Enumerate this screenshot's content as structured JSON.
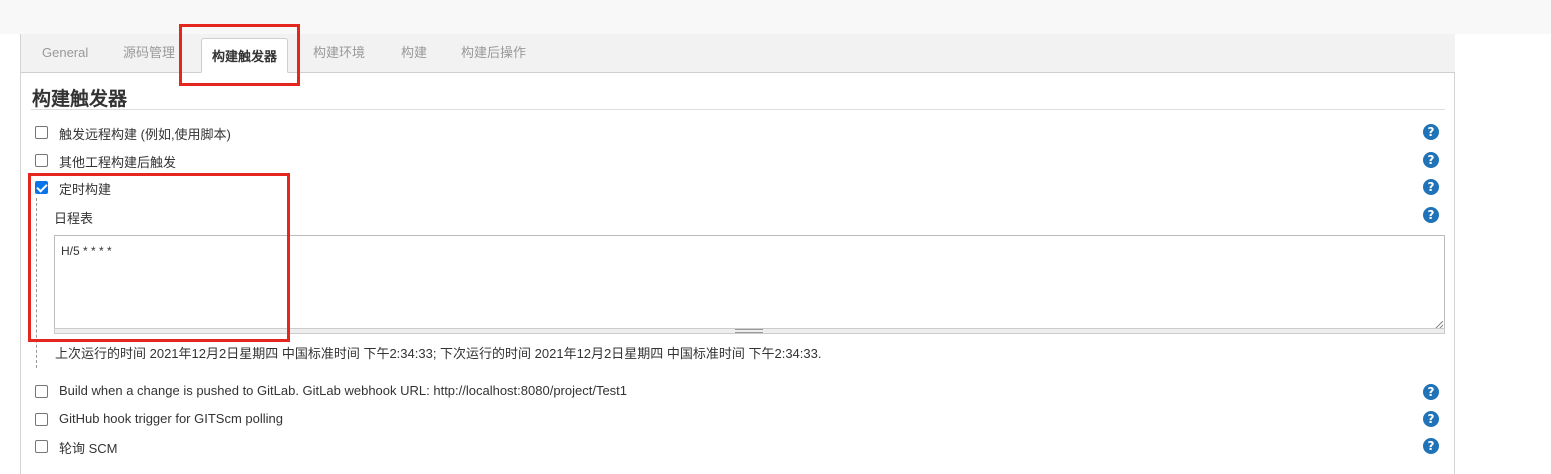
{
  "tabs": [
    {
      "label": "General"
    },
    {
      "label": "源码管理"
    },
    {
      "label": "构建触发器",
      "active": true
    },
    {
      "label": "构建环境"
    },
    {
      "label": "构建"
    },
    {
      "label": "构建后操作"
    }
  ],
  "section": {
    "title": "构建触发器"
  },
  "triggers": [
    {
      "label": "触发远程构建 (例如,使用脚本)",
      "checked": false
    },
    {
      "label": "其他工程构建后触发",
      "checked": false
    },
    {
      "label": "定时构建",
      "checked": true
    },
    {
      "label": "Build when a change is pushed to GitLab. GitLab webhook URL: http://localhost:8080/project/Test1",
      "checked": false
    },
    {
      "label": "GitHub hook trigger for GITScm polling",
      "checked": false
    },
    {
      "label": "轮询 SCM",
      "checked": false
    }
  ],
  "schedule": {
    "label": "日程表",
    "value": "H/5 * * * *",
    "run_info": "上次运行的时间 2021年12月2日星期四 中国标准时间 下午2:34:33; 下次运行的时间 2021年12月2日星期四 中国标准时间 下午2:34:33."
  },
  "help": {
    "symbol": "?"
  },
  "colors": {
    "highlight": "#e5261f",
    "help_icon": "#2073b6",
    "checkbox_checked": "#0a75ea"
  }
}
